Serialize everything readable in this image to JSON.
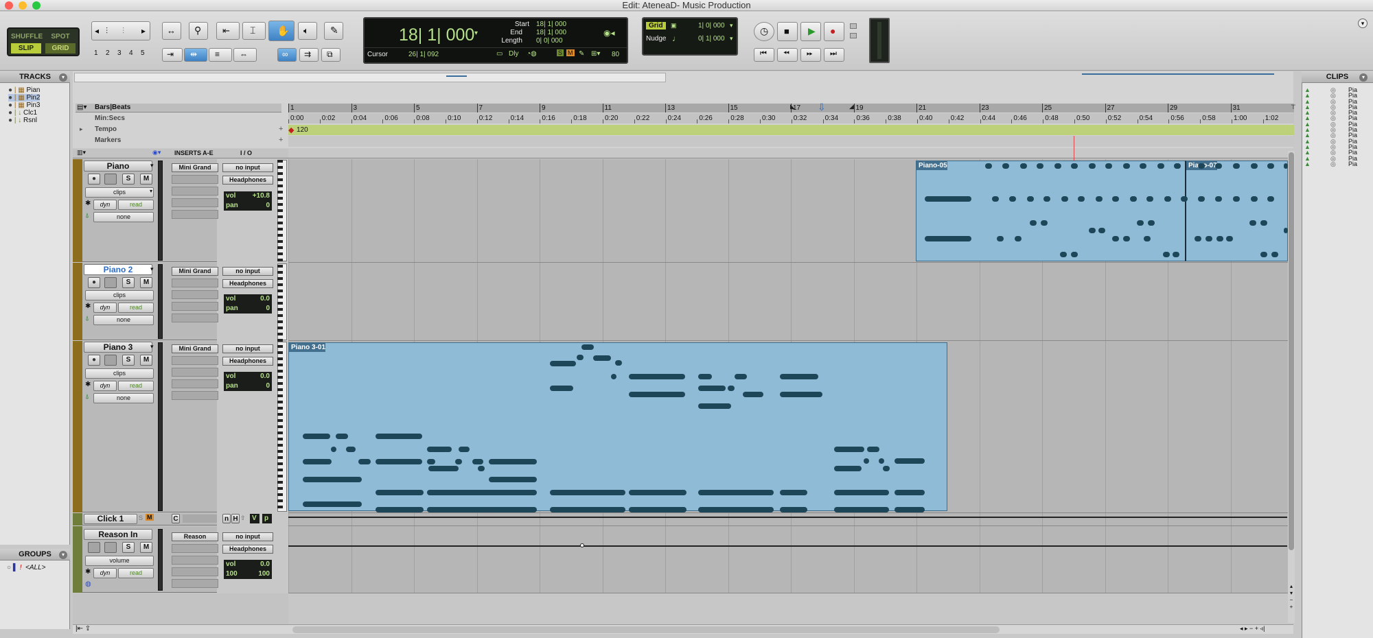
{
  "window": {
    "title": "Edit: AteneaD- Music Production"
  },
  "modes": {
    "shuffle": "SHUFFLE",
    "spot": "SPOT",
    "slip": "SLIP",
    "grid": "GRID"
  },
  "zoom_presets": [
    "1",
    "2",
    "3",
    "4",
    "5"
  ],
  "counter": {
    "main": "18| 1| 000",
    "start_label": "Start",
    "start": "18| 1| 000",
    "end_label": "End",
    "end": "18| 1| 000",
    "length_label": "Length",
    "length": "0| 0| 000",
    "cursor_label": "Cursor",
    "cursor": "26| 1| 092",
    "dly": "Dly",
    "s": "S",
    "m": "M",
    "tempo_value": "80"
  },
  "grid": {
    "grid_label": "Grid",
    "grid_value": "1| 0| 000",
    "nudge_label": "Nudge",
    "nudge_value": "0| 1| 000"
  },
  "tracks_panel": {
    "title": "TRACKS",
    "items": [
      "Pian",
      "Pin2",
      "Pin3",
      "Clc1",
      "Rsnl"
    ]
  },
  "groups_panel": {
    "title": "GROUPS",
    "items": [
      "<ALL>"
    ]
  },
  "clips_panel": {
    "title": "CLIPS",
    "items": [
      "Pia",
      "Pia",
      "Pia",
      "Pia",
      "Pia",
      "Pia",
      "Pia",
      "Pia",
      "Pia",
      "Pia",
      "Pia",
      "Pia",
      "Pia",
      "Pia"
    ]
  },
  "rulers": {
    "bars_label": "Bars|Beats",
    "min_label": "Min:Secs",
    "tempo_label": "Tempo",
    "markers_label": "Markers",
    "tempo_value": "120",
    "bars": [
      "1",
      "3",
      "5",
      "7",
      "9",
      "11",
      "13",
      "15",
      "17",
      "19",
      "21",
      "23",
      "25",
      "27",
      "29",
      "31"
    ],
    "mins": [
      "0:00",
      "0:02",
      "0:04",
      "0:06",
      "0:08",
      "0:10",
      "0:12",
      "0:14",
      "0:16",
      "0:18",
      "0:20",
      "0:22",
      "0:24",
      "0:26",
      "0:28",
      "0:30",
      "0:32",
      "0:34",
      "0:36",
      "0:38",
      "0:40",
      "0:42",
      "0:44",
      "0:46",
      "0:48",
      "0:50",
      "0:52",
      "0:54",
      "0:56",
      "0:58",
      "1:00",
      "1:02"
    ]
  },
  "columns": {
    "inserts": "INSERTS A-E",
    "io": "I / O"
  },
  "tracks": [
    {
      "name": "Piano",
      "clips": "clips",
      "dyn": "dyn",
      "read": "read",
      "none": "none",
      "insert": "Mini Grand",
      "input": "no input",
      "output": "Headphones",
      "vol_label": "vol",
      "vol": "+10.8",
      "pan_label": "pan",
      "pan": "0"
    },
    {
      "name": "Piano 2",
      "clips": "clips",
      "dyn": "dyn",
      "read": "read",
      "none": "none",
      "insert": "Mini Grand",
      "input": "no input",
      "output": "Headphones",
      "vol_label": "vol",
      "vol": "0.0",
      "pan_label": "pan",
      "pan": "0"
    },
    {
      "name": "Piano 3",
      "clips": "clips",
      "dyn": "dyn",
      "read": "read",
      "none": "none",
      "insert": "Mini Grand",
      "input": "no input",
      "output": "Headphones",
      "vol_label": "vol",
      "vol": "0.0",
      "pan_label": "pan",
      "pan": "0"
    },
    {
      "name": "Click 1",
      "c": "C",
      "n": "n",
      "h": "H",
      "v": "V",
      "p": "p"
    },
    {
      "name": "Reason In",
      "clips": "volume",
      "dyn": "dyn",
      "read": "read",
      "insert": "Reason",
      "input": "no input",
      "output": "Headphones",
      "vol_label": "vol",
      "vol": "0.0",
      "pan_l": "100",
      "pan_r": "100"
    }
  ],
  "clips": [
    {
      "name": "Piano-05"
    },
    {
      "name": "Piano-07"
    },
    {
      "name": "Piano 3-01"
    }
  ],
  "colors": {
    "clip_fill": "#8fbbd7",
    "note": "#1e4659",
    "track_bar": "#8d6d1e",
    "lcd_text": "#b6e08a"
  }
}
